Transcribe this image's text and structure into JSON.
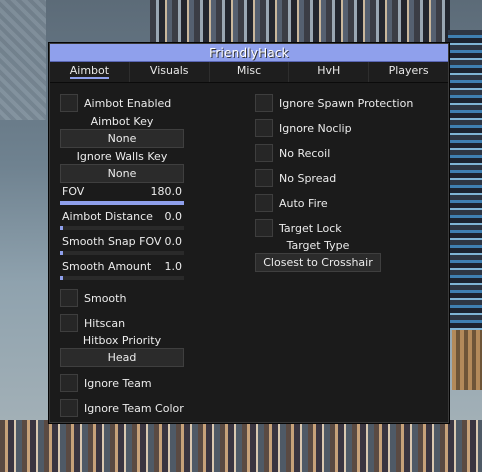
{
  "window": {
    "title": "FriendlyHack"
  },
  "tabs": [
    {
      "label": "Aimbot",
      "active": true
    },
    {
      "label": "Visuals",
      "active": false
    },
    {
      "label": "Misc",
      "active": false
    },
    {
      "label": "HvH",
      "active": false
    },
    {
      "label": "Players",
      "active": false
    }
  ],
  "left": {
    "aimbot_enabled": "Aimbot Enabled",
    "aimbot_key_label": "Aimbot Key",
    "aimbot_key_value": "None",
    "ignore_walls_key_label": "Ignore Walls Key",
    "ignore_walls_key_value": "None",
    "fov": {
      "label": "FOV",
      "value": "180.0",
      "fraction": 1.0
    },
    "aimbot_distance": {
      "label": "Aimbot Distance",
      "value": "0.0",
      "fraction": 0.0
    },
    "smooth_snap_fov": {
      "label": "Smooth Snap FOV",
      "value": "0.0",
      "fraction": 0.0
    },
    "smooth_amount": {
      "label": "Smooth Amount",
      "value": "1.0",
      "fraction": 0.0
    },
    "smooth": "Smooth",
    "hitscan": "Hitscan",
    "hitbox_priority_label": "Hitbox Priority",
    "hitbox_priority_value": "Head",
    "ignore_team": "Ignore Team",
    "ignore_team_color": "Ignore Team Color"
  },
  "right": {
    "ignore_spawn_protection": "Ignore Spawn Protection",
    "ignore_noclip": "Ignore Noclip",
    "no_recoil": "No Recoil",
    "no_spread": "No Spread",
    "auto_fire": "Auto Fire",
    "target_lock": "Target Lock",
    "target_type_label": "Target Type",
    "target_type_value": "Closest to Crosshair"
  },
  "colors": {
    "accent": "#8fa0ec",
    "panel": "#1b1b1b",
    "control": "#2b2b2b"
  }
}
